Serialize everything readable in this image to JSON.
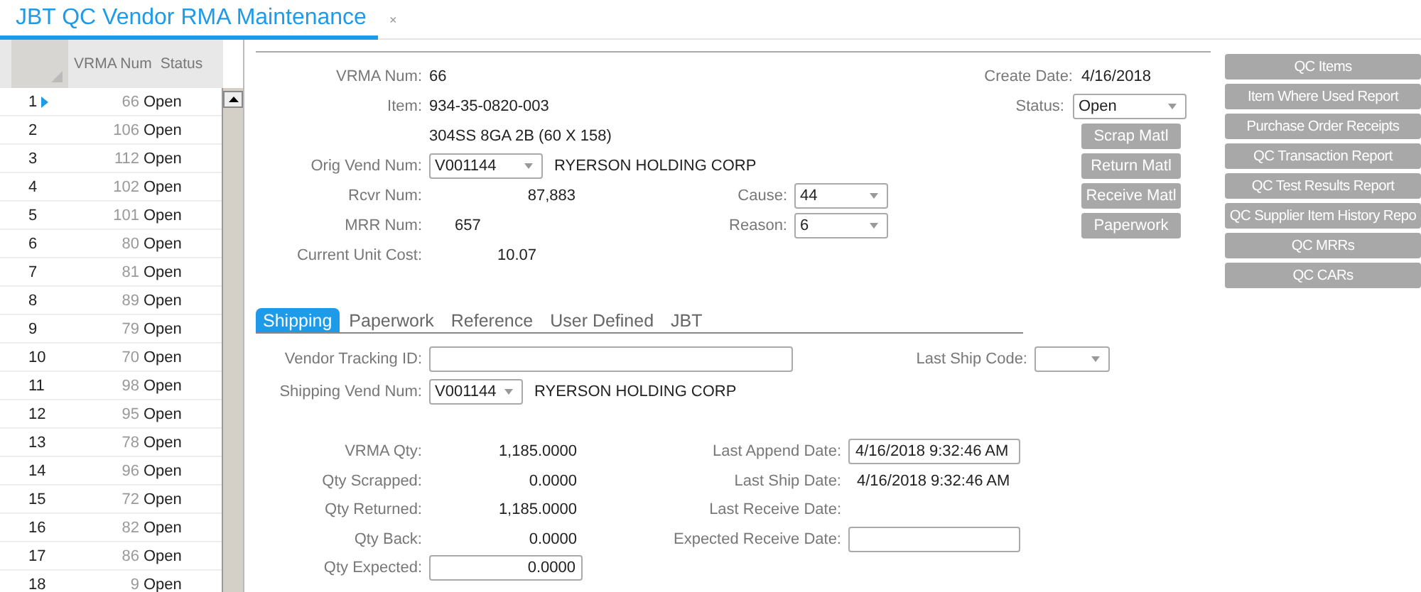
{
  "document_tab": {
    "title": "JBT QC Vendor RMA Maintenance",
    "close": "×"
  },
  "grid": {
    "columns": [
      "VRMA Num",
      "Status"
    ],
    "rows": [
      {
        "row": "1",
        "vrma_num": "66",
        "status": "Open",
        "selected": true
      },
      {
        "row": "2",
        "vrma_num": "106",
        "status": "Open",
        "selected": false
      },
      {
        "row": "3",
        "vrma_num": "112",
        "status": "Open",
        "selected": false
      },
      {
        "row": "4",
        "vrma_num": "102",
        "status": "Open",
        "selected": false
      },
      {
        "row": "5",
        "vrma_num": "101",
        "status": "Open",
        "selected": false
      },
      {
        "row": "6",
        "vrma_num": "80",
        "status": "Open",
        "selected": false
      },
      {
        "row": "7",
        "vrma_num": "81",
        "status": "Open",
        "selected": false
      },
      {
        "row": "8",
        "vrma_num": "89",
        "status": "Open",
        "selected": false
      },
      {
        "row": "9",
        "vrma_num": "79",
        "status": "Open",
        "selected": false
      },
      {
        "row": "10",
        "vrma_num": "70",
        "status": "Open",
        "selected": false
      },
      {
        "row": "11",
        "vrma_num": "98",
        "status": "Open",
        "selected": false
      },
      {
        "row": "12",
        "vrma_num": "95",
        "status": "Open",
        "selected": false
      },
      {
        "row": "13",
        "vrma_num": "78",
        "status": "Open",
        "selected": false
      },
      {
        "row": "14",
        "vrma_num": "96",
        "status": "Open",
        "selected": false
      },
      {
        "row": "15",
        "vrma_num": "72",
        "status": "Open",
        "selected": false
      },
      {
        "row": "16",
        "vrma_num": "82",
        "status": "Open",
        "selected": false
      },
      {
        "row": "17",
        "vrma_num": "86",
        "status": "Open",
        "selected": false
      },
      {
        "row": "18",
        "vrma_num": "9",
        "status": "Open",
        "selected": false
      }
    ]
  },
  "header": {
    "vrma_num": {
      "label": "VRMA Num:",
      "value": "66"
    },
    "item": {
      "label": "Item:",
      "value": "934-35-0820-003"
    },
    "item_description": "304SS 8GA 2B (60 X 158)",
    "orig_vend_num": {
      "label": "Orig Vend Num:",
      "value": "V001144",
      "vendor_name": "RYERSON HOLDING CORP"
    },
    "rcvr_num": {
      "label": "Rcvr Num:",
      "value": "87,883"
    },
    "mrr_num": {
      "label": "MRR Num:",
      "value": "657"
    },
    "current_unit_cost": {
      "label": "Current Unit Cost:",
      "value": "10.07"
    },
    "cause": {
      "label": "Cause:",
      "value": "44"
    },
    "reason": {
      "label": "Reason:",
      "value": "6"
    },
    "create_date": {
      "label": "Create Date:",
      "value": "4/16/2018"
    },
    "status": {
      "label": "Status:",
      "value": "Open"
    },
    "actions": [
      "Scrap Matl",
      "Return Matl",
      "Receive Matl",
      "Paperwork"
    ]
  },
  "reports": [
    "QC Items",
    "Item Where Used Report",
    "Purchase Order Receipts",
    "QC Transaction Report",
    "QC Test Results Report",
    "QC Supplier Item History Repo",
    "QC MRRs",
    "QC CARs"
  ],
  "tabs": [
    {
      "label": "Shipping",
      "selected": true
    },
    {
      "label": "Paperwork",
      "selected": false
    },
    {
      "label": "Reference",
      "selected": false
    },
    {
      "label": "User Defined",
      "selected": false
    },
    {
      "label": "JBT",
      "selected": false
    }
  ],
  "shipping": {
    "vendor_tracking_id": {
      "label": "Vendor Tracking ID:"
    },
    "last_ship_code": {
      "label": "Last Ship Code:"
    },
    "shipping_vend_num": {
      "label": "Shipping Vend Num:",
      "value": "V001144",
      "vendor_name": "RYERSON HOLDING CORP"
    },
    "quantities": [
      {
        "label": "VRMA Qty:",
        "value": "1,185.0000",
        "kind": "text"
      },
      {
        "label": "Qty Scrapped:",
        "value": "0.0000",
        "kind": "text"
      },
      {
        "label": "Qty Returned:",
        "value": "1,185.0000",
        "kind": "text"
      },
      {
        "label": "Qty Back:",
        "value": "0.0000",
        "kind": "text"
      },
      {
        "label": "Qty Expected:",
        "value": "0.0000",
        "kind": "input"
      }
    ],
    "dates": [
      {
        "label": "Last Append Date:",
        "value": "4/16/2018 9:32:46 AM",
        "kind": "input"
      },
      {
        "label": "Last Ship Date:",
        "value": "4/16/2018 9:32:46 AM",
        "kind": "text"
      },
      {
        "label": "Last Receive Date:",
        "kind": "text"
      },
      {
        "label": "Expected Receive Date:",
        "kind": "input"
      }
    ]
  }
}
